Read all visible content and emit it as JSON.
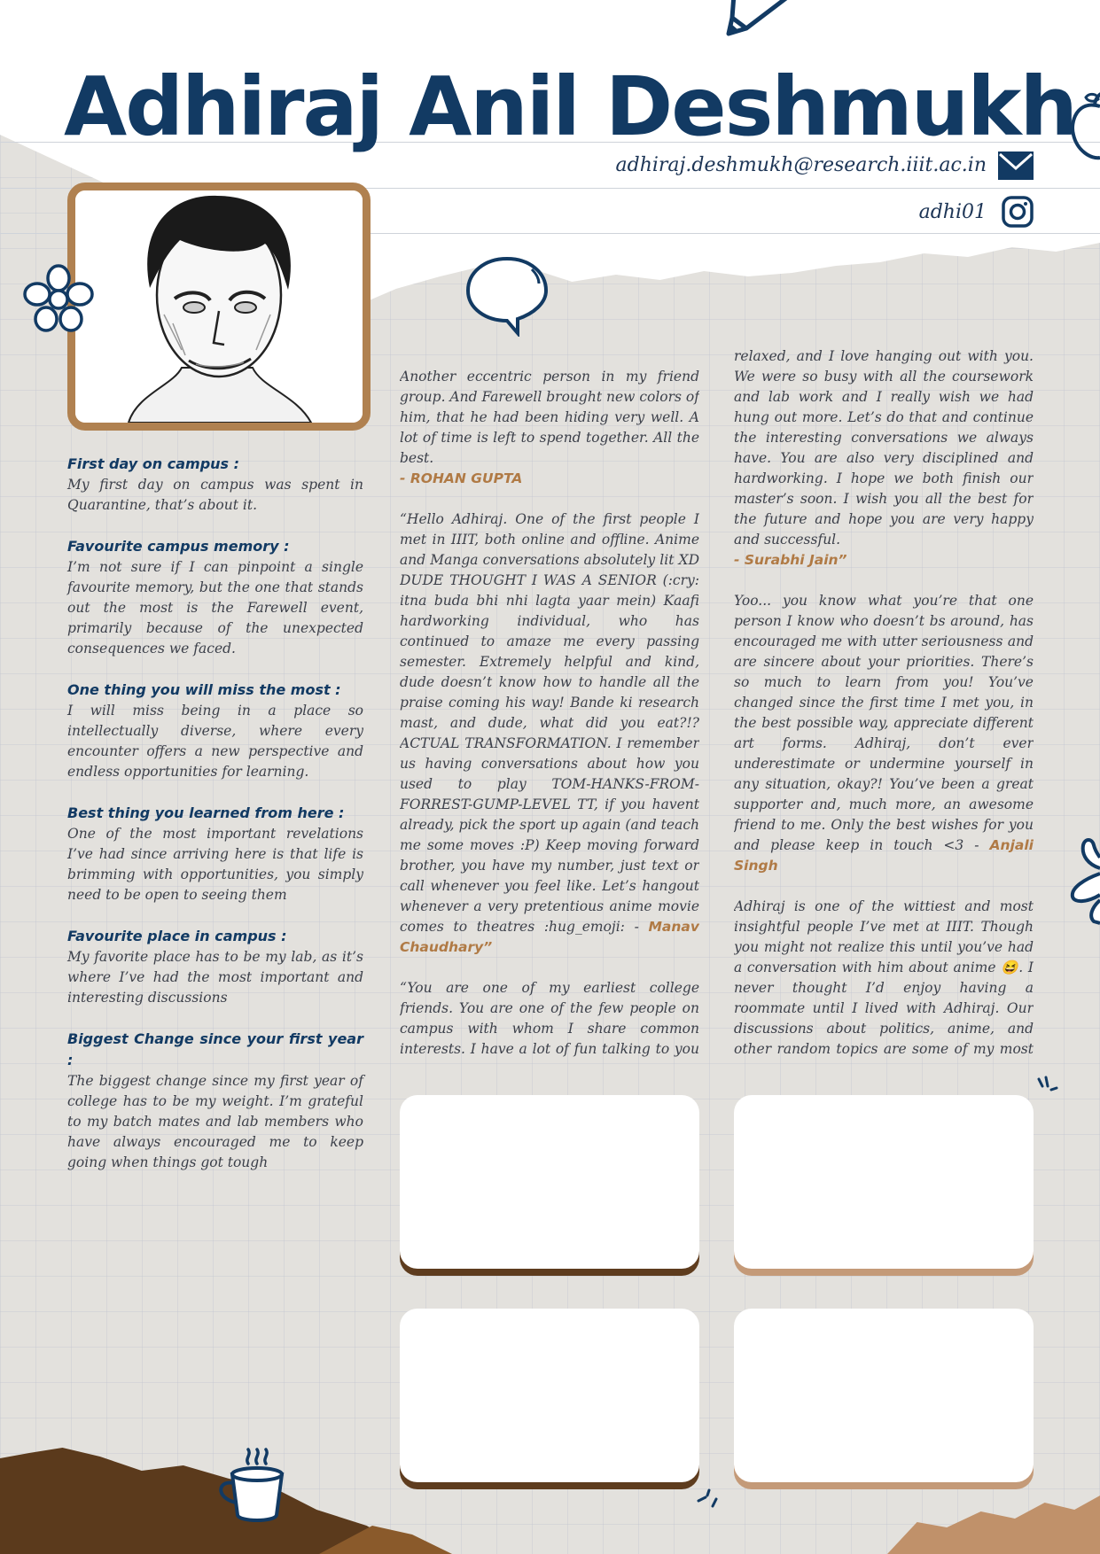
{
  "header": {
    "name": "Adhiraj Anil Deshmukh",
    "email": "adhiraj.deshmukh@research.iiit.ac.in",
    "instagram": "adhi01"
  },
  "colors": {
    "navy": "#123a63",
    "accent_brown": "#b07a45",
    "frame_brown": "#b08150",
    "dark_brown": "#5b3a1c",
    "paper": "#e3e1dd"
  },
  "icons": [
    "mail-icon",
    "instagram-icon",
    "pencil-icon",
    "flower-icon",
    "speech-bubble-icon",
    "coffee-cup-icon",
    "apple-icon",
    "hand-icon",
    "sparkle-icon"
  ],
  "questions": [
    {
      "title": "First day on campus :",
      "answer": "My first day on campus was spent in Quarantine, that’s about it."
    },
    {
      "title": "Favourite campus memory :",
      "answer": "I’m not sure if I can pinpoint a single favourite memory, but the one that stands out the most is the Farewell event, primarily because of the unexpected consequences we faced."
    },
    {
      "title": "One thing you will miss the most :",
      "answer": "I will miss being in a place so intellectually diverse, where every encounter offers a new perspective and endless opportunities for learning."
    },
    {
      "title": "Best thing you learned from here :",
      "answer": "One of the most important revelations I’ve had since arriving here is that life is brimming with opportunities, you simply need to be open to seeing them"
    },
    {
      "title": "Favourite place in campus :",
      "answer": "My favorite place has to be my lab, as it’s where I’ve had the most important and interesting discussions"
    },
    {
      "title": "Biggest Change since your first year :",
      "answer": "The biggest change since my first year of college has to be my weight. I’m grateful to my batch mates and lab members who have always encouraged me to keep going when things got tough"
    }
  ],
  "messages_col1": [
    {
      "text": "Another eccentric person in my friend group. And Farewell brought new colors of him, that he had been hiding very well. A lot of time is left to spend together.  All the best.",
      "signature": "- ROHAN GUPTA"
    },
    {
      "text": "“Hello Adhiraj.  One of the first people I met in IIIT, both online and offline. Anime and Manga conversations absolutely lit XD DUDE THOUGHT I WAS A SENIOR (:cry: itna buda bhi nhi lagta yaar mein) Kaafi hardworking individual, who has continued to amaze me every passing semester. Extremely helpful and kind, dude doesn’t know how to handle all the praise coming his way! Bande ki research mast, and dude, what did you eat?!? ACTUAL TRANSFORMATION. I remember us having conversations about how you used to play TOM-HANKS-FROM-FORREST-GUMP-LEVEL TT, if you havent already, pick the sport up again (and teach me some moves :P) Keep moving forward brother, you have my number, just text or call whenever you feel like. Let’s hangout whenever a very pretentious anime movie comes to theatres :hug_emoji: -",
      "signature": "Manav Chaudhary”"
    },
    {
      "text": "“You are one of my earliest college friends. You are one of the few people on campus with whom I share common interests. I have a lot of fun talking to you and chatting about my favorite movies, shows, and books. You always seem very calm and",
      "signature": ""
    }
  ],
  "messages_col2": [
    {
      "text": "relaxed, and I love hanging out with you. We were so busy with all the coursework and lab work and I really wish we had hung out more. Let’s do that and continue the interesting conversations we always have. You are also very disciplined and hardworking. I hope we both finish our master’s soon. I wish you all the best for the future and hope you are very happy and successful.",
      "signature": "- Surabhi Jain”"
    },
    {
      "text": "Yoo... you know what you’re that one person I know who doesn’t bs around, has encouraged me with utter seriousness and are sincere about your priorities. There’s so much to learn from you! You’ve changed since the first time I met you, in the best possible way, appreciate different art forms. Adhiraj, don’t ever underestimate or undermine yourself in any situation, okay?! You’ve been a great supporter and, much more, an awesome friend to me. Only the best wishes for you and please keep in touch <3 -",
      "signature": "Anjali Singh"
    },
    {
      "text": "Adhiraj is one of the wittiest and most insightful people I’ve met at IIIT. Though you might not realize this until you’ve had a conversation with him about anime 😆. I never thought I’d enjoy having a roommate until I lived with Adhiraj. Our discussions about politics, anime, and other random topics are some of my most cherished memories from IIIT. I’ll never forget the rat incident or the HGB Twitter account. I hope",
      "signature": ""
    }
  ]
}
